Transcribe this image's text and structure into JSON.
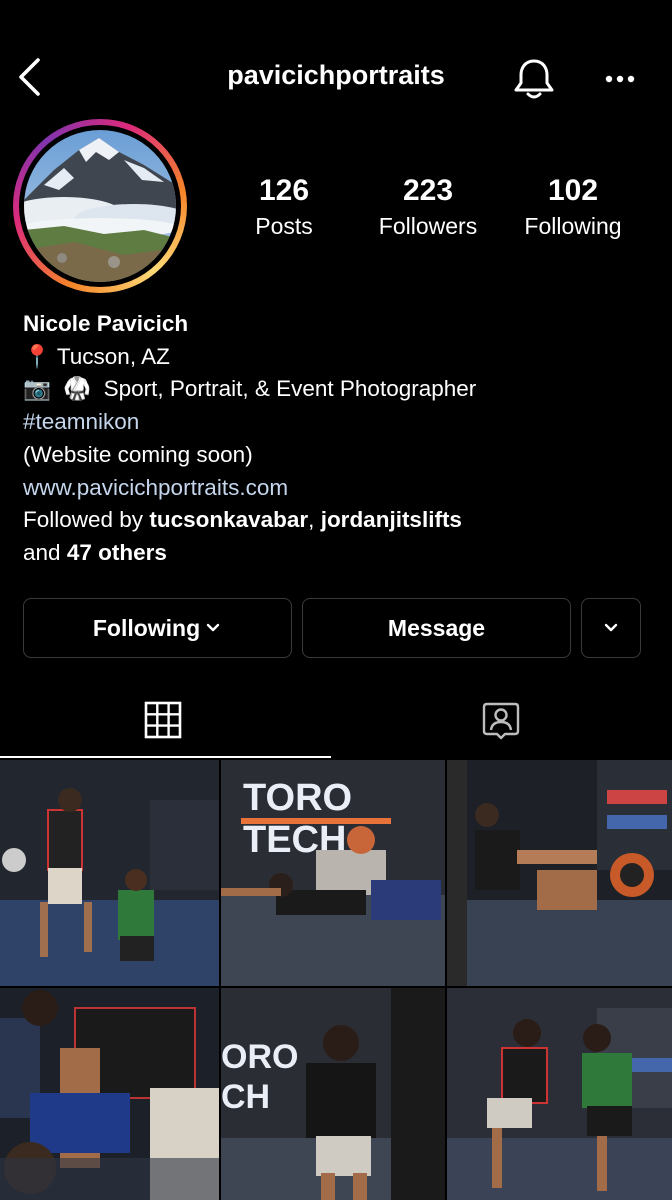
{
  "header": {
    "username": "pavicichportraits",
    "back_icon": "chevron-left-icon",
    "bell_icon": "bell-icon",
    "more_icon": "more-horizontal-icon"
  },
  "stats": [
    {
      "value": "126",
      "label": "Posts"
    },
    {
      "value": "223",
      "label": "Followers"
    },
    {
      "value": "102",
      "label": "Following"
    }
  ],
  "bio": {
    "name": "Nicole Pavicich",
    "location_emoji": "📍",
    "location": "Tucson, AZ",
    "camera_emoji": "📷",
    "gi_emoji": "🥋",
    "description": "Sport, Portrait, & Event Photographer",
    "hashtag": "#teamnikon",
    "note": "(Website coming soon)",
    "website": "www.pavicichportraits.com",
    "followed_by_prefix": "Followed by",
    "followed_by_user1": "tucsonkavabar",
    "followed_by_sep": ",",
    "followed_by_user2": "jordanjitslifts",
    "followed_by_and": "and",
    "followed_by_others": "47 others"
  },
  "actions": {
    "following_label": "Following",
    "message_label": "Message"
  },
  "tabs": {
    "grid_icon": "grid-icon",
    "tagged_icon": "tagged-person-icon",
    "active": "grid"
  },
  "grid": {
    "posts": [
      {
        "alt": "post-1",
        "banner_text": ""
      },
      {
        "alt": "post-2",
        "banner_text": "TORO TECH"
      },
      {
        "alt": "post-3",
        "banner_text": ""
      },
      {
        "alt": "post-4",
        "banner_text": ""
      },
      {
        "alt": "post-5",
        "banner_text": "ORO CH"
      },
      {
        "alt": "post-6",
        "banner_text": ""
      }
    ]
  },
  "colors": {
    "background": "#000000",
    "text": "#ffffff",
    "link": "#c5d6ec",
    "button_border": "#3a3a3a"
  }
}
